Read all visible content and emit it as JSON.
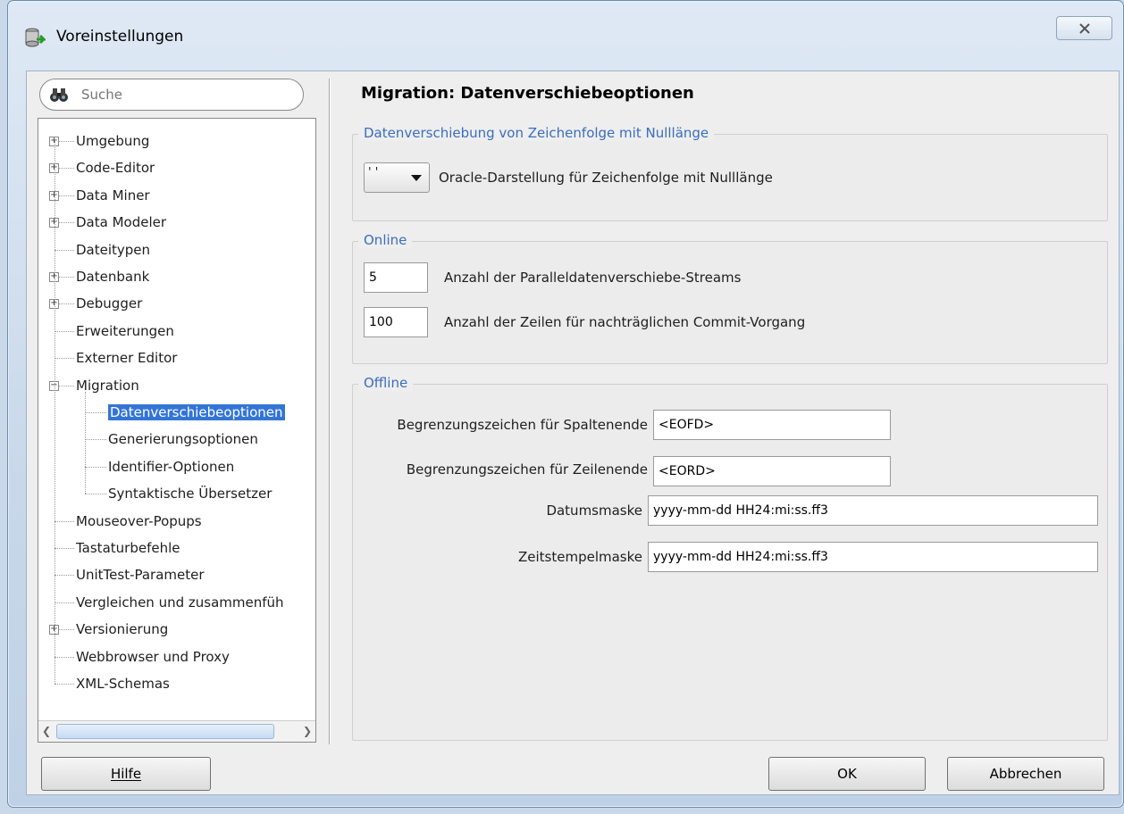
{
  "window": {
    "title": "Voreinstellungen"
  },
  "search": {
    "placeholder": "Suche"
  },
  "tree": {
    "items": [
      {
        "label": "Umgebung",
        "expandable": true
      },
      {
        "label": "Code-Editor",
        "expandable": true
      },
      {
        "label": "Data Miner",
        "expandable": true
      },
      {
        "label": "Data Modeler",
        "expandable": true
      },
      {
        "label": "Dateitypen",
        "expandable": false
      },
      {
        "label": "Datenbank",
        "expandable": true
      },
      {
        "label": "Debugger",
        "expandable": true
      },
      {
        "label": "Erweiterungen",
        "expandable": false
      },
      {
        "label": "Externer Editor",
        "expandable": false
      },
      {
        "label": "Migration",
        "expandable": true,
        "expanded": true
      },
      {
        "label": "Datenverschiebeoptionen",
        "child": true,
        "selected": true
      },
      {
        "label": "Generierungsoptionen",
        "child": true
      },
      {
        "label": "Identifier-Optionen",
        "child": true
      },
      {
        "label": "Syntaktische Übersetzer",
        "child": true
      },
      {
        "label": "Mouseover-Popups",
        "expandable": false
      },
      {
        "label": "Tastaturbefehle",
        "expandable": false
      },
      {
        "label": "UnitTest-Parameter",
        "expandable": false
      },
      {
        "label": "Vergleichen und zusammenfüh",
        "expandable": false
      },
      {
        "label": "Versionierung",
        "expandable": true
      },
      {
        "label": "Webbrowser und Proxy",
        "expandable": false
      },
      {
        "label": "XML-Schemas",
        "expandable": false
      }
    ]
  },
  "page": {
    "title": "Migration: Datenverschiebeoptionen"
  },
  "group_null": {
    "legend": "Datenverschiebung von Zeichenfolge mit Nulllänge",
    "combo_value": "' '",
    "combo_label": "Oracle-Darstellung für Zeichenfolge mit Nulllänge"
  },
  "group_online": {
    "legend": "Online",
    "streams_value": "5",
    "streams_label": "Anzahl der Paralleldatenverschiebe-Streams",
    "commit_value": "100",
    "commit_label": "Anzahl der Zeilen für nachträglichen Commit-Vorgang"
  },
  "group_offline": {
    "legend": "Offline",
    "col_end_label": "Begrenzungszeichen für Spaltenende",
    "col_end_value": "<EOFD>",
    "row_end_label": "Begrenzungszeichen für Zeilenende",
    "row_end_value": "<EORD>",
    "date_mask_label": "Datumsmaske",
    "date_mask_value": "yyyy-mm-dd HH24:mi:ss.ff3",
    "ts_mask_label": "Zeitstempelmaske",
    "ts_mask_value": "yyyy-mm-dd HH24:mi:ss.ff3"
  },
  "buttons": {
    "help": "Hilfe",
    "ok": "OK",
    "cancel": "Abbrechen"
  },
  "colors": {
    "accent": "#3375d6",
    "legend": "#3a6dbf"
  }
}
